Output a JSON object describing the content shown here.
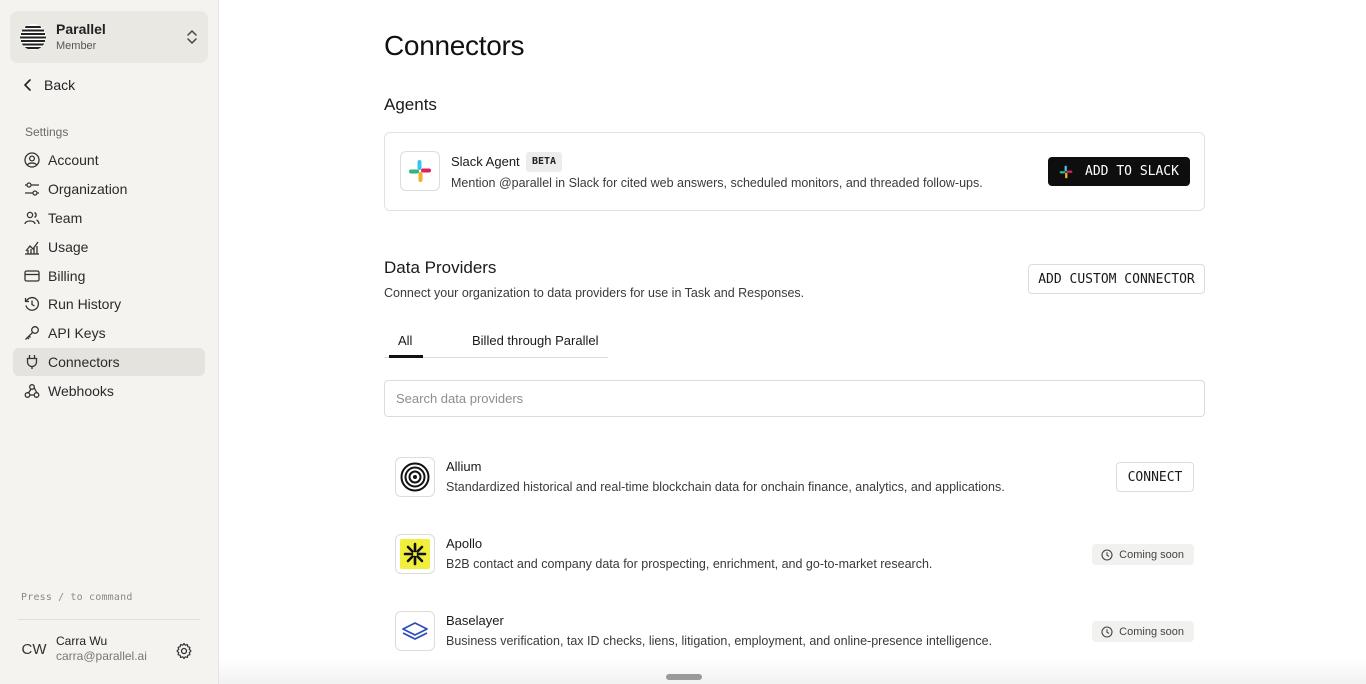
{
  "org": {
    "name": "Parallel",
    "role": "Member"
  },
  "sidebar": {
    "back_label": "Back",
    "section_label": "Settings",
    "items": [
      {
        "label": "Account",
        "icon": "user-circle-icon"
      },
      {
        "label": "Organization",
        "icon": "sliders-icon"
      },
      {
        "label": "Team",
        "icon": "users-icon"
      },
      {
        "label": "Usage",
        "icon": "chart-icon"
      },
      {
        "label": "Billing",
        "icon": "credit-card-icon"
      },
      {
        "label": "Run History",
        "icon": "history-icon"
      },
      {
        "label": "API Keys",
        "icon": "key-icon"
      },
      {
        "label": "Connectors",
        "icon": "plug-icon",
        "active": true
      },
      {
        "label": "Webhooks",
        "icon": "webhook-icon"
      }
    ],
    "command_hint": {
      "prefix": "Press",
      "key": "/",
      "suffix": "to command"
    }
  },
  "user": {
    "initials": "CW",
    "name": "Carra Wu",
    "email": "carra@parallel.ai"
  },
  "main": {
    "title": "Connectors",
    "agents_heading": "Agents",
    "agent": {
      "name": "Slack Agent",
      "badge": "BETA",
      "description": "Mention @parallel in Slack for cited web answers, scheduled monitors, and threaded follow-ups.",
      "button_label": "ADD TO SLACK"
    },
    "data_providers_heading": "Data Providers",
    "data_providers_description": "Connect your organization to data providers for use in Task and Responses.",
    "add_custom_label": "ADD CUSTOM CONNECTOR",
    "tabs": [
      {
        "label": "All",
        "active": true
      },
      {
        "label": "Billed through Parallel"
      }
    ],
    "search_placeholder": "Search data providers",
    "providers": [
      {
        "name": "Allium",
        "description": "Standardized historical and real-time blockchain data for onchain finance, analytics, and applications.",
        "action": "CONNECT"
      },
      {
        "name": "Apollo",
        "description": "B2B contact and company data for prospecting, enrichment, and go-to-market research.",
        "status": "Coming soon"
      },
      {
        "name": "Baselayer",
        "description": "Business verification, tax ID checks, liens, litigation, employment, and online-presence intelligence.",
        "status": "Coming soon"
      }
    ]
  },
  "colors": {
    "sidebar_bg": "#f4f3ef",
    "active_nav": "#e5e3dd",
    "primary_button": "#0e0e0e",
    "apollo_yellow": "#f0f03c"
  }
}
